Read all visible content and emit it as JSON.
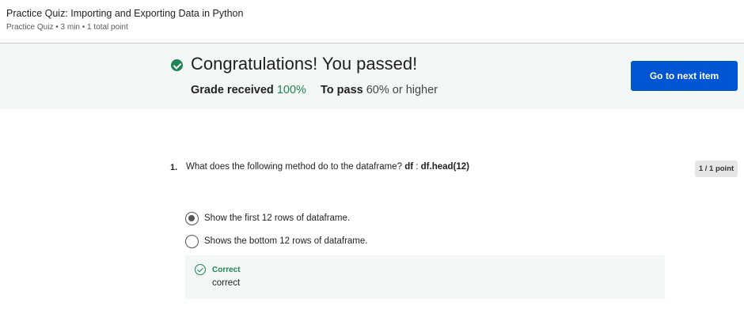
{
  "header": {
    "title": "Practice Quiz: Importing and Exporting Data in Python",
    "meta": "Practice Quiz • 3 min • 1 total point"
  },
  "result": {
    "headline": "Congratulations! You passed!",
    "grade_label": "Grade received",
    "grade_value": "100%",
    "pass_label": "To pass",
    "pass_value": "60% or higher",
    "icon": "check-circle-icon",
    "accent_color": "#1f8354"
  },
  "actions": {
    "next_label": "Go to next item",
    "button_color": "#0056d2"
  },
  "question": {
    "number": "1.",
    "text": "What does the following method do to the dataframe?",
    "code_prefix": "df",
    "code_sep": " : ",
    "code_method": "df.head(12)",
    "points": "1 / 1 point",
    "options": [
      {
        "label": "Show the first 12 rows of dataframe.",
        "selected": true
      },
      {
        "label": "Shows the bottom 12 rows of dataframe.",
        "selected": false
      }
    ],
    "feedback": {
      "title": "Correct",
      "text": "correct",
      "icon": "check-outline-icon"
    }
  }
}
